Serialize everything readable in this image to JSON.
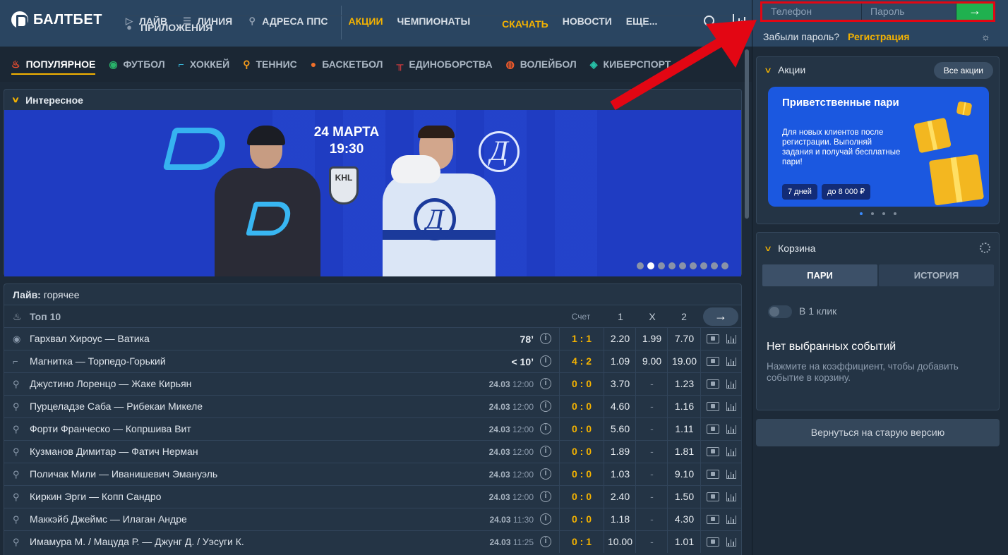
{
  "brand": {
    "name": "БАЛТБЕТ"
  },
  "nav": {
    "items": [
      {
        "label": "ЛАЙВ",
        "icon": "play-circle-icon"
      },
      {
        "label": "ЛИНИЯ",
        "icon": "list-icon"
      },
      {
        "label": "АДРЕСА ППС",
        "icon": "location-pin-icon"
      }
    ],
    "promos": "АКЦИИ",
    "championships": "ЧЕМПИОНАТЫ",
    "apps": "ПРИЛОЖЕНИЯ",
    "download": "СКАЧАТЬ",
    "news": "НОВОСТИ",
    "more": "ЕЩЕ..."
  },
  "login": {
    "phone_placeholder": "Телефон",
    "password_placeholder": "Пароль",
    "submit": "→",
    "forgot": "Забыли пароль?",
    "register": "Регистрация"
  },
  "sports_tabs": [
    {
      "label": "ПОПУЛЯРНОЕ",
      "icon": "flame-icon",
      "color": "#f04e30",
      "active": true
    },
    {
      "label": "ФУТБОЛ",
      "icon": "soccer-ball-icon",
      "color": "#29b36a"
    },
    {
      "label": "ХОККЕЙ",
      "icon": "hockey-stick-icon",
      "color": "#38b6d8"
    },
    {
      "label": "ТЕННИС",
      "icon": "tennis-racket-icon",
      "color": "#f29a1c"
    },
    {
      "label": "БАСКЕТБОЛ",
      "icon": "basketball-icon",
      "color": "#f0702a"
    },
    {
      "label": "ЕДИНОБОРСТВА",
      "icon": "boxing-ring-icon",
      "color": "#e43d3d"
    },
    {
      "label": "ВОЛЕЙБОЛ",
      "icon": "volleyball-icon",
      "color": "#f05a2a"
    },
    {
      "label": "КИБЕРСПОРТ",
      "icon": "esports-icon",
      "color": "#27c2a8"
    }
  ],
  "interesting": {
    "title": "Интересное",
    "banner": {
      "date": "24 МАРТА",
      "time": "19:30",
      "khl": "KHL"
    },
    "slides_total": 9,
    "slide_active": 2
  },
  "live": {
    "title_bold": "Лайв:",
    "title_rest": "горячее",
    "top_label": "Топ 10",
    "col_score": "Счет",
    "col_1": "1",
    "col_x": "X",
    "col_2": "2",
    "rows": [
      {
        "sport": "soccer-ball-icon",
        "teams": "Гархвал Хироус — Ватика",
        "time": "78’",
        "date": "",
        "clock": "",
        "score": "1 : 1",
        "o1": "2.20",
        "ox": "1.99",
        "o2": "7.70",
        "media": "tv"
      },
      {
        "sport": "hockey-stick-icon",
        "teams": "Магнитка — Торпедо-Горький",
        "time": "< 10’",
        "date": "",
        "clock": "",
        "score": "4 : 2",
        "o1": "1.09",
        "ox": "9.00",
        "o2": "19.00",
        "media": "video"
      },
      {
        "sport": "tennis-racket-icon",
        "teams": "Джустино Лоренцо — Жаке Кирьян",
        "time": "",
        "date": "24.03",
        "clock": "12:00",
        "score": "0 : 0",
        "o1": "3.70",
        "ox": "-",
        "o2": "1.23",
        "media": "tv"
      },
      {
        "sport": "tennis-racket-icon",
        "teams": "Пурцеладзе Саба — Рибекаи Микеле",
        "time": "",
        "date": "24.03",
        "clock": "12:00",
        "score": "0 : 0",
        "o1": "4.60",
        "ox": "-",
        "o2": "1.16",
        "media": "tv"
      },
      {
        "sport": "tennis-racket-icon",
        "teams": "Форти Франческо — Копршива Вит",
        "time": "",
        "date": "24.03",
        "clock": "12:00",
        "score": "0 : 0",
        "o1": "5.60",
        "ox": "-",
        "o2": "1.11",
        "media": "tv"
      },
      {
        "sport": "tennis-racket-icon",
        "teams": "Кузманов Димитар — Фатич Нерман",
        "time": "",
        "date": "24.03",
        "clock": "12:00",
        "score": "0 : 0",
        "o1": "1.89",
        "ox": "-",
        "o2": "1.81",
        "media": "tv"
      },
      {
        "sport": "tennis-racket-icon",
        "teams": "Поличак Мили — Иванишевич Эмануэль",
        "time": "",
        "date": "24.03",
        "clock": "12:00",
        "score": "0 : 0",
        "o1": "1.03",
        "ox": "-",
        "o2": "9.10",
        "media": "tv"
      },
      {
        "sport": "tennis-racket-icon",
        "teams": "Киркин Эрги — Копп Сандро",
        "time": "",
        "date": "24.03",
        "clock": "12:00",
        "score": "0 : 0",
        "o1": "2.40",
        "ox": "-",
        "o2": "1.50",
        "media": "tv"
      },
      {
        "sport": "tennis-racket-icon",
        "teams": "Маккэйб Джеймс — Илаган Андре",
        "time": "",
        "date": "24.03",
        "clock": "11:30",
        "score": "0 : 0",
        "o1": "1.18",
        "ox": "-",
        "o2": "4.30",
        "media": "tv"
      },
      {
        "sport": "tennis-racket-icon",
        "teams": "Имамура М. / Мацуда Р. — Джунг Д. / Уэсуги К.",
        "time": "",
        "date": "24.03",
        "clock": "11:25",
        "score": "0 : 1",
        "o1": "10.00",
        "ox": "-",
        "o2": "1.01",
        "media": "tv"
      }
    ]
  },
  "promos": {
    "title": "Акции",
    "all_button": "Все акции",
    "card": {
      "title": "Приветственные пари",
      "text": "Для новых клиентов после регистрации. Выполняй задания и получай бесплатные пари!",
      "badge_days": "7 дней",
      "badge_amount": "до 8 000 ₽"
    },
    "slides_total": 4,
    "slide_active": 1
  },
  "cart": {
    "title": "Корзина",
    "tab_bets": "ПАРИ",
    "tab_history": "ИСТОРИЯ",
    "one_click": "В 1 клик",
    "one_click_on": false,
    "empty_title": "Нет выбранных событий",
    "empty_hint": "Нажмите на коэффициент, чтобы добавить событие в корзину."
  },
  "old_version": "Вернуться на старую версию",
  "colors": {
    "accent": "#f5b300",
    "header": "#2a4561",
    "login_highlight": "#e30613",
    "submit_green": "#1fb14f"
  }
}
